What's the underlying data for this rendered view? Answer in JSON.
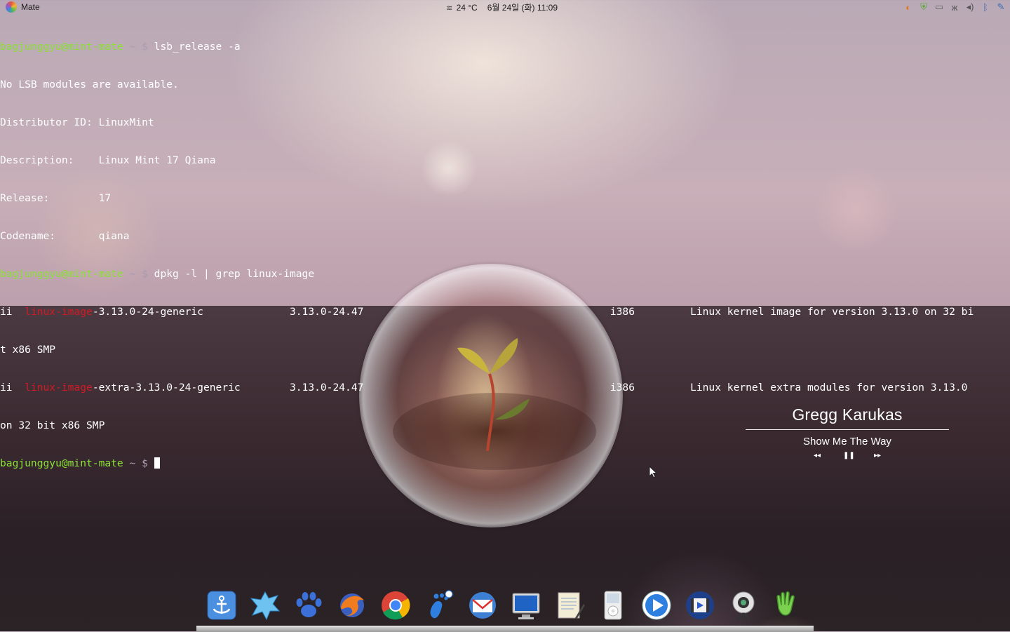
{
  "top_panel": {
    "menu_label": "Mate",
    "temperature": "24 °C",
    "date": "6월 24일 (화)",
    "time": "11:09",
    "tray_icons": [
      "update-manager-icon",
      "shield-icon",
      "screen-icon",
      "butterfly-icon",
      "volume-icon",
      "bluetooth-icon",
      "notes-icon"
    ]
  },
  "terminal": {
    "prompt_user": "bagjunggyu@mint-mate",
    "prompt_path": " ~ $ ",
    "lines": [
      {
        "type": "cmd",
        "text": "lsb_release -a"
      },
      {
        "type": "out",
        "text": "No LSB modules are available."
      },
      {
        "type": "out",
        "text": "Distributor ID: LinuxMint"
      },
      {
        "type": "out",
        "text": "Description:    Linux Mint 17 Qiana"
      },
      {
        "type": "out",
        "text": "Release:        17"
      },
      {
        "type": "out",
        "text": "Codename:       qiana"
      },
      {
        "type": "cmd",
        "text": "dpkg -l | grep linux-image"
      },
      {
        "type": "pkg",
        "prefix": "ii  ",
        "match": "linux-image",
        "rest": "-3.13.0-24-generic              3.13.0-24.47                                        i386         Linux kernel image for version 3.13.0 on 32 bi"
      },
      {
        "type": "out",
        "text": "t x86 SMP"
      },
      {
        "type": "pkg",
        "prefix": "ii  ",
        "match": "linux-image",
        "rest": "-extra-3.13.0-24-generic        3.13.0-24.47                                        i386         Linux kernel extra modules for version 3.13.0"
      },
      {
        "type": "out",
        "text": "on 32 bit x86 SMP"
      },
      {
        "type": "prompt",
        "text": ""
      }
    ]
  },
  "music_widget": {
    "artist": "Gregg Karukas",
    "song": "Show Me The Way",
    "prev_label": "◂◂",
    "pause_label": "❚❚",
    "next_label": "▸▸"
  },
  "dock": {
    "items": [
      {
        "name": "anchor-icon",
        "color": "#3d7fd0"
      },
      {
        "name": "splash-icon",
        "color": "#5ab4e8"
      },
      {
        "name": "paw-icon",
        "color": "#3a6fd8"
      },
      {
        "name": "firefox-icon",
        "color": "#e86a1c"
      },
      {
        "name": "chrome-icon",
        "color": "#2f9e3f"
      },
      {
        "name": "pidgin-foot-icon",
        "color": "#2a7ad8"
      },
      {
        "name": "mail-client-icon",
        "color": "#d23a2a"
      },
      {
        "name": "monitor-icon",
        "color": "#1b5fb8"
      },
      {
        "name": "notepad-icon",
        "color": "#e9e2c9"
      },
      {
        "name": "ipod-icon",
        "color": "#e5e5e5"
      },
      {
        "name": "media-player-icon",
        "color": "#2d7fe0"
      },
      {
        "name": "video-editor-icon",
        "color": "#2a5bc8"
      },
      {
        "name": "webcam-icon",
        "color": "#cfcfcf"
      },
      {
        "name": "hand-wave-icon",
        "color": "#6fc24a"
      }
    ]
  }
}
